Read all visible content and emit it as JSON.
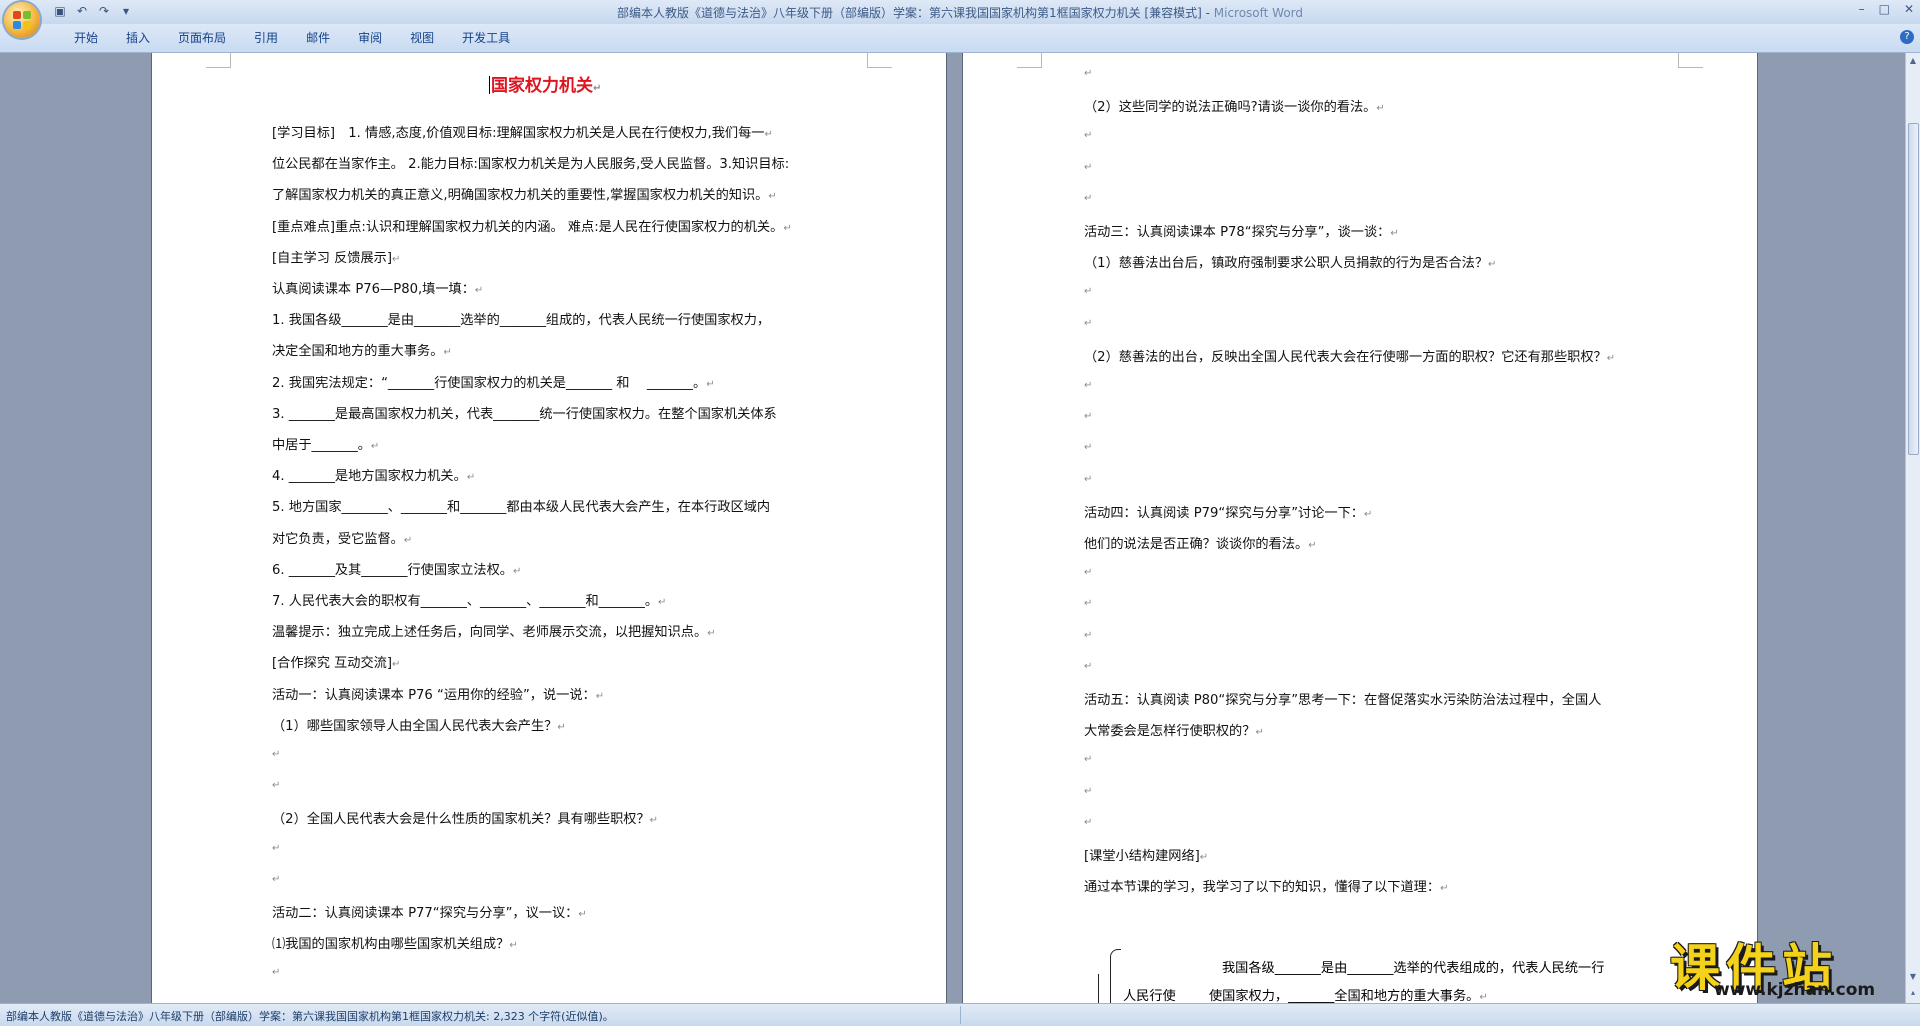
{
  "window": {
    "title": "部编本人教版《道德与法治》八年级下册（部编版）学案：第六课我国国家机构第1框国家权力机关 [兼容模式]",
    "app_name": "Microsoft Word"
  },
  "ribbon": {
    "tabs": [
      "开始",
      "插入",
      "页面布局",
      "引用",
      "邮件",
      "审阅",
      "视图",
      "开发工具"
    ]
  },
  "page1": {
    "title": "国家权力机关",
    "lines": [
      "[学习目标]　1. 情感,态度,价值观目标:理解国家权力机关是人民在行使权力,我们每一",
      "位公民都在当家作主。 2.能力目标:国家权力机关是为人民服务,受人民监督。3.知识目标:",
      "了解国家权力机关的真正意义,明确国家权力机关的重要性,掌握国家权力机关的知识。",
      "[重点难点]重点:认识和理解国家权力机关的内涵。 难点:是人民在行使国家权力的机关。",
      "[自主学习 反馈展示]",
      "认真阅读课本 P76—P80,填一填：",
      "1. 我国各级_______是由_______选举的_______组成的，代表人民统一行使国家权力，",
      "决定全国和地方的重大事务。",
      "2. 我国宪法规定：“_______行使国家权力的机关是_______ 和　 _______。",
      "3. _______是最高国家权力机关，代表_______统一行使国家权力。在整个国家机关体系",
      "中居于_______。",
      "4. _______是地方国家权力机关。",
      "5. 地方国家_______、_______和_______都由本级人民代表大会产生，在本行政区域内",
      "对它负责，受它监督。",
      "6. _______及其_______行使国家立法权。",
      "7. 人民代表大会的职权有_______、_______、_______和_______。",
      "温馨提示：独立完成上述任务后，向同学、老师展示交流，以把握知识点。",
      "[合作探究 互动交流]",
      "活动一：认真阅读课本 P76 “运用你的经验”，说一说：",
      "（1）哪些国家领导人由全国人民代表大会产生？",
      "",
      "",
      "（2）全国人民代表大会是什么性质的国家机关？具有哪些职权？",
      "",
      "",
      "活动二：认真阅读课本 P77“探究与分享”，议一议：",
      "⑴我国的国家机构由哪些国家机关组成？",
      ""
    ],
    "endings": [
      true,
      false,
      true,
      true,
      true,
      true,
      false,
      true,
      true,
      false,
      true,
      true,
      false,
      true,
      true,
      true,
      true,
      true,
      true,
      true,
      true,
      true,
      true,
      true,
      true,
      true,
      true,
      true
    ]
  },
  "page2": {
    "lines": [
      "",
      "（2）这些同学的说法正确吗?请谈一谈你的看法。",
      "",
      "",
      "",
      "活动三：认真阅读课本 P78“探究与分享”，谈一谈：",
      "（1）慈善法出台后，镇政府强制要求公职人员捐款的行为是否合法？",
      "",
      "",
      "（2）慈善法的出台，反映出全国人民代表大会在行使哪一方面的职权？它还有那些职权？",
      "",
      "",
      "",
      "",
      "活动四：认真阅读 P79“探究与分享”讨论一下：",
      "他们的说法是否正确？谈谈你的看法。",
      "",
      "",
      "",
      "",
      "活动五：认真阅读 P80“探究与分享”思考一下：在督促落实水污染防治法过程中，全国人",
      "大常委会是怎样行使职权的？",
      "",
      "",
      "",
      "[课堂小结构建网络]",
      " 通过本节课的学习，我学习了以下的知识，懂得了以下道理："
    ],
    "endings": [
      true,
      true,
      true,
      true,
      true,
      true,
      true,
      true,
      true,
      true,
      true,
      true,
      true,
      true,
      true,
      true,
      true,
      true,
      true,
      true,
      false,
      true,
      true,
      true,
      true,
      true,
      true
    ],
    "summary": {
      "box_label": "人民行使",
      "line1": "我国各级_______是由_______选举的代表组成的，代表人民统一行",
      "line2": "使国家权力，_______全国和地方的重大事务。"
    }
  },
  "paragraph_mark": "↵",
  "statusbar": {
    "text": "部编本人教版《道德与法治》八年级下册（部编版）学案：第六课我国国家机构第1框国家权力机关: 2,323 个字符(近似值)。"
  },
  "watermark": {
    "cn": "课件站",
    "url": "www.kjzhan.com"
  }
}
